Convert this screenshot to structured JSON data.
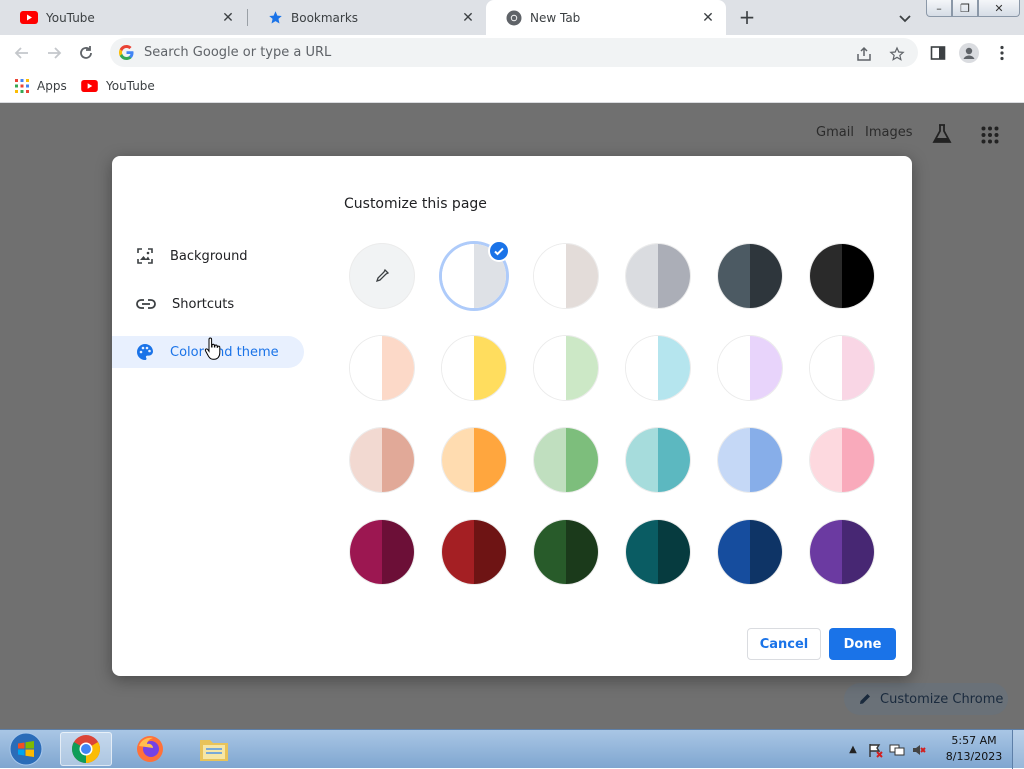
{
  "tabs": [
    {
      "label": "YouTube",
      "icon": "youtube-icon"
    },
    {
      "label": "Bookmarks",
      "icon": "star-icon"
    },
    {
      "label": "New Tab",
      "icon": "chrome-icon",
      "active": true
    }
  ],
  "window_buttons": {
    "minimize": "–",
    "restore": "❐",
    "close": "✕"
  },
  "toolbar": {
    "omnibox_placeholder": "Search Google or type a URL"
  },
  "bookmarks": [
    {
      "label": "Apps",
      "icon": "apps-grid-icon"
    },
    {
      "label": "YouTube",
      "icon": "youtube-icon"
    }
  ],
  "ntp": {
    "gmail_label": "Gmail",
    "images_label": "Images",
    "customize_chrome_label": "Customize Chrome"
  },
  "dialog": {
    "title": "Customize this page",
    "nav": [
      {
        "label": "Background",
        "icon": "image-icon"
      },
      {
        "label": "Shortcuts",
        "icon": "link-icon"
      },
      {
        "label": "Color and theme",
        "icon": "palette-icon",
        "selected": true
      }
    ],
    "cancel_label": "Cancel",
    "done_label": "Done",
    "swatches": [
      [
        {
          "custom": true
        },
        {
          "l": "#ffffff",
          "r": "#dee1e6",
          "selected": true
        },
        {
          "l": "#ffffff",
          "r": "#e3dcd9"
        },
        {
          "l": "#dadce0",
          "r": "#abaeb7"
        },
        {
          "l": "#4c5a63",
          "r": "#2e363c"
        },
        {
          "l": "#2a2a2a",
          "r": "#000000"
        }
      ],
      [
        {
          "l": "#ffffff",
          "r": "#fcd9c8"
        },
        {
          "l": "#ffffff",
          "r": "#ffdd5e"
        },
        {
          "l": "#ffffff",
          "r": "#cce8c6"
        },
        {
          "l": "#ffffff",
          "r": "#b5e5ee"
        },
        {
          "l": "#ffffff",
          "r": "#e8d4fb"
        },
        {
          "l": "#ffffff",
          "r": "#f9d6e5"
        }
      ],
      [
        {
          "l": "#f2d9d1",
          "r": "#e1a998"
        },
        {
          "l": "#ffdcb0",
          "r": "#ffa63e"
        },
        {
          "l": "#c0dfbf",
          "r": "#7dbe7c"
        },
        {
          "l": "#a6dcdc",
          "r": "#5cb8c0"
        },
        {
          "l": "#c5d8f6",
          "r": "#87aee9"
        },
        {
          "l": "#fdd9df",
          "r": "#f9aabb"
        }
      ],
      [
        {
          "l": "#9c1751",
          "r": "#6c0f37"
        },
        {
          "l": "#a41f23",
          "r": "#6e1414"
        },
        {
          "l": "#285b2a",
          "r": "#1b3a1b"
        },
        {
          "l": "#0a5c63",
          "r": "#063b3f"
        },
        {
          "l": "#164d9e",
          "r": "#0e3466"
        },
        {
          "l": "#6b3aa1",
          "r": "#472773"
        }
      ]
    ]
  },
  "taskbar": {
    "clock_time": "5:57 AM",
    "clock_date": "8/13/2023"
  },
  "colors": {
    "accent": "#1a73e8",
    "selected_nav_bg": "#e8f0fe"
  }
}
